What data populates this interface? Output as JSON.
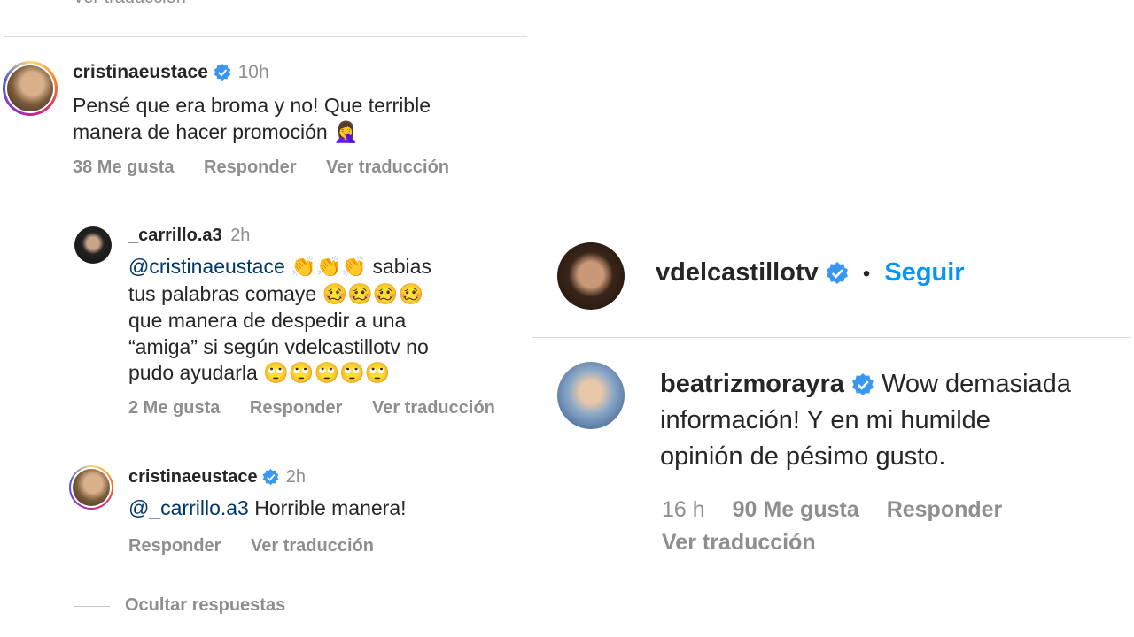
{
  "left": {
    "top_link": "Ver traducción",
    "comment1": {
      "username": "cristinaeustace",
      "time": "10h",
      "line1": "Pensé que era broma y no! Que terrible",
      "line2": "manera de hacer promoción",
      "emoji": "🤦‍♀️",
      "likes": "38 Me gusta",
      "reply": "Responder",
      "translate": "Ver traducción"
    },
    "comment2": {
      "username": "_carrillo.a3",
      "time": "2h",
      "mention": "@cristinaeustace",
      "clap": "👏👏👏",
      "line1_rest": "sabias",
      "line2": "tus palabras comaye",
      "line2_emoji": "🥴🥴🥴🥴",
      "line3": "que manera de despedir a una",
      "line4": "“amiga” si según vdelcastillotv no",
      "line5": "pudo ayudarla",
      "line5_emoji": "🙄🙄🙄🙄🙄",
      "likes": "2 Me gusta",
      "reply": "Responder",
      "translate": "Ver traducción"
    },
    "comment3": {
      "username": "cristinaeustace",
      "time": "2h",
      "mention": "@_carrillo.a3",
      "text": "Horrible manera!",
      "reply": "Responder",
      "translate": "Ver traducción"
    },
    "hide_replies": "Ocultar respuestas"
  },
  "right": {
    "header": {
      "username": "vdelcastillotv",
      "dot": "•",
      "follow": "Seguir"
    },
    "comment": {
      "username": "beatrizmorayra",
      "line1_rest": "Wow demasiada",
      "line2": "información! Y en mi humilde",
      "line3": "opinión de pésimo gusto.",
      "time": "16 h",
      "likes": "90 Me gusta",
      "reply": "Responder",
      "translate": "Ver traducción"
    }
  },
  "colors": {
    "verified": "#3897f0",
    "link_blue": "#0095f6",
    "mention_blue": "#00376b",
    "muted": "#8e8e8e"
  }
}
